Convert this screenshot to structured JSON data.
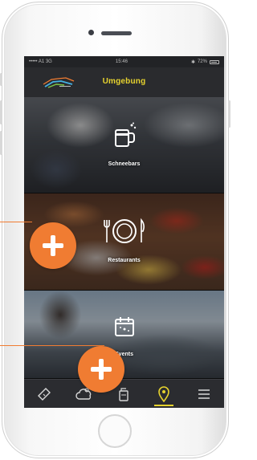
{
  "status_bar": {
    "carrier": "••••• A1 3G",
    "time": "15:46",
    "battery": "72%"
  },
  "header": {
    "title": "Umgebung"
  },
  "tiles": [
    {
      "label": "Schneebars",
      "icon": "beer-mug-icon"
    },
    {
      "label": "Restaurants",
      "icon": "plate-cutlery-icon"
    },
    {
      "label": "Events",
      "icon": "calendar-icon"
    }
  ],
  "tabbar": {
    "items": [
      {
        "icon": "ticket-icon",
        "active": false
      },
      {
        "icon": "weather-cloud-icon",
        "active": false
      },
      {
        "icon": "drink-cup-icon",
        "active": false
      },
      {
        "icon": "location-pin-icon",
        "active": true
      },
      {
        "icon": "menu-icon",
        "active": false
      }
    ]
  },
  "colors": {
    "accent": "#e6d22e",
    "callout": "#f07c32",
    "header_bg": "#2a2b2e",
    "tabbar_bg": "#2b2c30"
  }
}
